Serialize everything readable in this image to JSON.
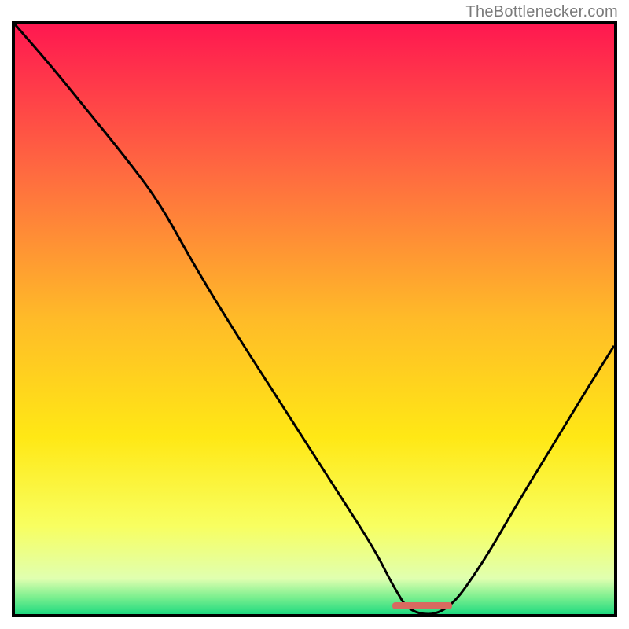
{
  "watermark": "TheBottlenecker.com",
  "chart_data": {
    "type": "line",
    "title": "",
    "xlabel": "",
    "ylabel": "",
    "xlim": [
      0,
      100
    ],
    "ylim": [
      0,
      100
    ],
    "gradient_stops": [
      {
        "offset": 0,
        "color": "#ff1850"
      },
      {
        "offset": 25,
        "color": "#ff6a40"
      },
      {
        "offset": 50,
        "color": "#ffbb28"
      },
      {
        "offset": 70,
        "color": "#ffe815"
      },
      {
        "offset": 85,
        "color": "#f8ff60"
      },
      {
        "offset": 94,
        "color": "#e0ffb0"
      },
      {
        "offset": 97,
        "color": "#80f090"
      },
      {
        "offset": 100,
        "color": "#20da80"
      }
    ],
    "series": [
      {
        "name": "bottleneck-curve",
        "x": [
          0.0,
          6.0,
          12.0,
          18.0,
          24.0,
          30.0,
          36.0,
          42.0,
          48.0,
          54.0,
          60.0,
          63.0,
          66.0,
          72.0,
          78.0,
          84.0,
          90.0,
          96.0,
          100.0
        ],
        "y": [
          100.0,
          93.0,
          85.5,
          78.0,
          70.0,
          59.0,
          49.0,
          39.5,
          30.0,
          20.5,
          11.0,
          5.0,
          0.0,
          0.0,
          8.5,
          19.0,
          29.0,
          39.0,
          45.5
        ]
      }
    ],
    "annotations": [
      {
        "type": "segment",
        "name": "optimal-range",
        "x_start": 63.0,
        "x_end": 73.0,
        "y": 0.0,
        "color": "#d96a60"
      }
    ]
  }
}
